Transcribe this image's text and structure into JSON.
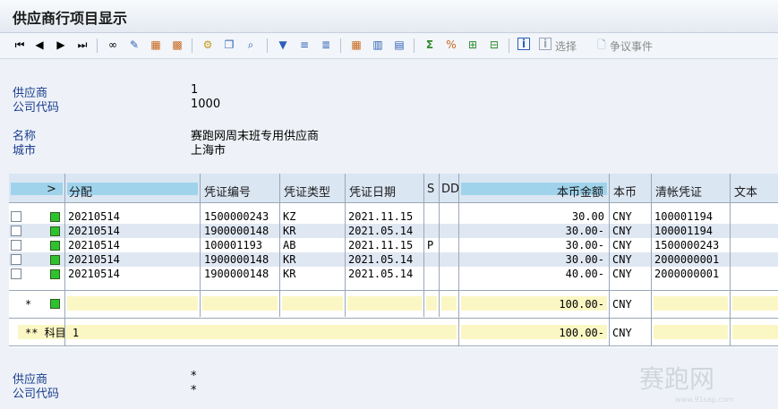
{
  "window": {
    "title": "供应商行项目显示"
  },
  "toolbar": {
    "select_label": "选择",
    "dispute_label": "争议事件"
  },
  "header": {
    "vendor_label": "供应商",
    "vendor_value": "1",
    "company_label": "公司代码",
    "company_value": "1000",
    "name_label": "名称",
    "name_value": "赛跑网周末班专用供应商",
    "city_label": "城市",
    "city_value": "上海市"
  },
  "grid": {
    "columns": {
      "expand": ">",
      "assign": "分配",
      "docno": "凭证编号",
      "doctype": "凭证类型",
      "docdate": "凭证日期",
      "s": "S",
      "dd": "DD",
      "amount": "本币金额",
      "currency": "本币",
      "clearing": "清帐凭证",
      "text": "文本"
    },
    "rows": [
      {
        "assign": "20210514",
        "docno": "1500000243",
        "type": "KZ",
        "date": "2021.11.15",
        "s": "",
        "amount": "30.00",
        "cur": "CNY",
        "clear": "100001194"
      },
      {
        "assign": "20210514",
        "docno": "1900000148",
        "type": "KR",
        "date": "2021.05.14",
        "s": "",
        "amount": "30.00-",
        "cur": "CNY",
        "clear": "100001194"
      },
      {
        "assign": "20210514",
        "docno": "100001193",
        "type": "AB",
        "date": "2021.11.15",
        "s": "P",
        "amount": "30.00-",
        "cur": "CNY",
        "clear": "1500000243"
      },
      {
        "assign": "20210514",
        "docno": "1900000148",
        "type": "KR",
        "date": "2021.05.14",
        "s": "",
        "amount": "30.00-",
        "cur": "CNY",
        "clear": "2000000001"
      },
      {
        "assign": "20210514",
        "docno": "1900000148",
        "type": "KR",
        "date": "2021.05.14",
        "s": "",
        "amount": "40.00-",
        "cur": "CNY",
        "clear": "2000000001"
      }
    ],
    "subtotal": {
      "mark": "*",
      "amount": "100.00-",
      "cur": "CNY"
    },
    "total": {
      "label": "** 科目 1",
      "amount": "100.00-",
      "cur": "CNY"
    }
  },
  "footer": {
    "vendor_label": "供应商",
    "vendor_value": "*",
    "company_label": "公司代码",
    "company_value": "*"
  },
  "watermark": {
    "text": "赛跑网",
    "url": "www.91sap.com"
  },
  "colors": {
    "header_bg": "#dbe6f3",
    "header_cell": "#9fd3ec",
    "total_row": "#fbf7c4",
    "status_green": "#2ec22e"
  }
}
